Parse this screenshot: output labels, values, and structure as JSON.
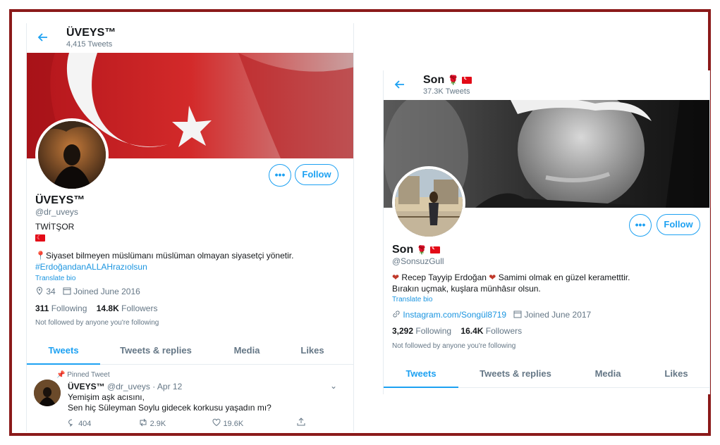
{
  "colors": {
    "accent": "#1da1f2",
    "border": "#8b1a1a",
    "flag": "#e30a17"
  },
  "profile1": {
    "header_name": "ÜVEYS™",
    "header_tweets": "4,415 Tweets",
    "name": "ÜVEYS™",
    "handle": "@dr_uveys",
    "bio_line1": "TWİTŞOR",
    "bio_line2": "Siyaset bilmeyen müslümanı müslüman olmayan siyasetçi yönetir.",
    "bio_hashtag": "#ErdoğandanALLAHrazıolsun",
    "translate": "Translate bio",
    "location": "34",
    "joined": "Joined June 2016",
    "following_count": "311",
    "following_label": "Following",
    "followers_count": "14.8K",
    "followers_label": "Followers",
    "not_followed": "Not followed by anyone you're following",
    "follow_label": "Follow",
    "more_label": "•••",
    "tabs": [
      "Tweets",
      "Tweets & replies",
      "Media",
      "Likes"
    ],
    "pinned": {
      "label": "Pinned Tweet",
      "author": "ÜVEYS™",
      "handle_date": "@dr_uveys · Apr 12",
      "line1": "Yemişim aşk acısını,",
      "line2": "Sen hiç Süleyman Soylu gidecek korkusu yaşadın mı?",
      "replies": "404",
      "retweets": "2.9K",
      "likes": "19.6K"
    }
  },
  "profile2": {
    "header_name": "Son",
    "header_tweets": "37.3K Tweets",
    "name": "Son",
    "handle": "@SonsuzGull",
    "bio_name": "Recep Tayyip Erdoğan",
    "bio_rest": "Samimi olmak en güzel kerametttir.",
    "bio_line2": "Bırakın uçmak, kuşlara münhâsır olsun.",
    "translate": "Translate bio",
    "link": "Instagram.com/Songül8719",
    "joined": "Joined June 2017",
    "following_count": "3,292",
    "following_label": "Following",
    "followers_count": "16.4K",
    "followers_label": "Followers",
    "not_followed": "Not followed by anyone you're following",
    "follow_label": "Follow",
    "more_label": "•••",
    "tabs": [
      "Tweets",
      "Tweets & replies",
      "Media",
      "Likes"
    ]
  }
}
